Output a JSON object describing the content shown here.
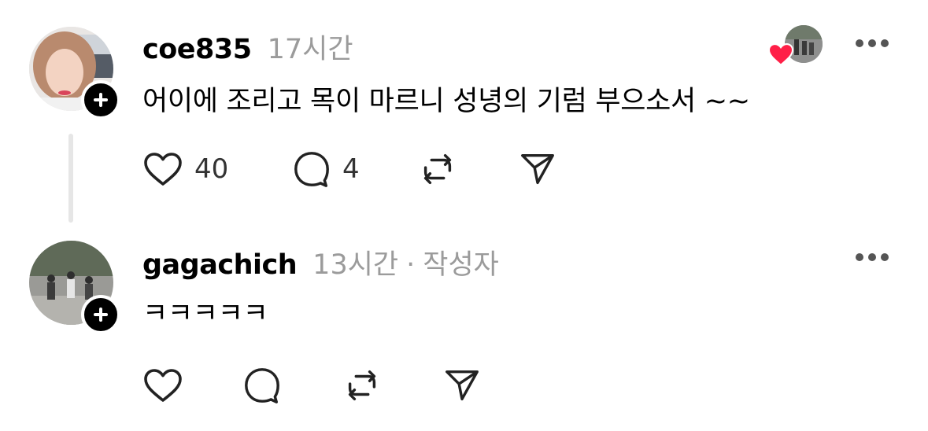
{
  "posts": [
    {
      "username": "coe835",
      "time": "17시간",
      "text": "어이에 조리고 목이 마르니 성녕의 기럼 부으소서 ~~",
      "likes": "40",
      "replies": "4"
    },
    {
      "username": "gagachich",
      "time": "13시간",
      "separator": "·",
      "author_badge": "작성자",
      "text": "ㅋㅋㅋㅋㅋ"
    }
  ],
  "icons": {
    "like": "heart-icon",
    "reply": "comment-icon",
    "repost": "repost-icon",
    "share": "send-icon",
    "follow": "plus-icon",
    "more": "more-icon"
  },
  "colors": {
    "liked_heart": "#ff1f47",
    "meta_gray": "#9b9b9b",
    "thread_line": "#e6e6e6"
  }
}
